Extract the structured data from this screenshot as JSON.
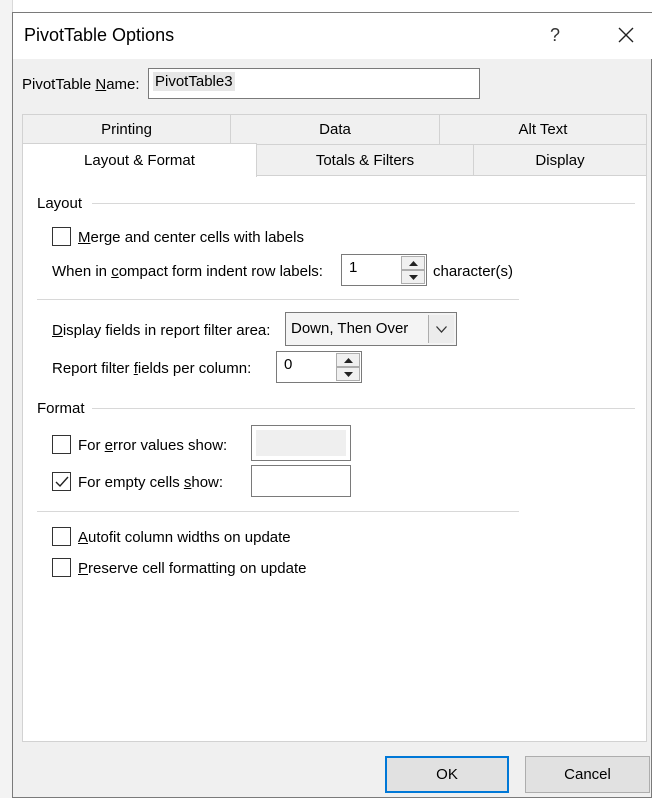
{
  "dialog": {
    "title": "PivotTable Options",
    "help_label": "?",
    "name_label_pre": "PivotTable ",
    "name_label_access": "N",
    "name_label_post": "ame:",
    "name_value": "PivotTable3"
  },
  "tabs": {
    "row1": [
      "Printing",
      "Data",
      "Alt Text"
    ],
    "row2": [
      "Layout & Format",
      "Totals & Filters",
      "Display"
    ],
    "active": "Layout & Format"
  },
  "layout": {
    "section_title": "Layout",
    "merge": {
      "access": "M",
      "rest": "erge and center cells with labels",
      "checked": false
    },
    "indent": {
      "pre": "When in ",
      "access": "c",
      "post": "ompact form indent row labels:",
      "value": "1",
      "unit": "character(s)"
    },
    "display_fields": {
      "access": "D",
      "post": "isplay fields in report filter area:",
      "value": "Down, Then Over"
    },
    "per_column": {
      "pre": "Report filter ",
      "access": "f",
      "post": "ields per column:",
      "value": "0"
    }
  },
  "format": {
    "section_title": "Format",
    "error_values": {
      "pre": "For ",
      "access": "e",
      "post": "rror values show:",
      "checked": false,
      "value": ""
    },
    "empty_cells": {
      "pre": "For empty cells ",
      "access": "s",
      "post": "how:",
      "checked": true,
      "value": ""
    },
    "autofit": {
      "access": "A",
      "rest": "utofit column widths on update",
      "checked": false
    },
    "preserve": {
      "access": "P",
      "rest": "reserve cell formatting on update",
      "checked": false
    }
  },
  "buttons": {
    "ok": "OK",
    "cancel": "Cancel"
  },
  "icons": [
    "close-icon",
    "spin-up-icon",
    "spin-down-icon",
    "chevron-down-icon",
    "checkmark-icon"
  ],
  "colors": {
    "accent": "#0078d7",
    "dialog_bg": "#f0f0f0",
    "panel_bg": "#ffffff"
  }
}
